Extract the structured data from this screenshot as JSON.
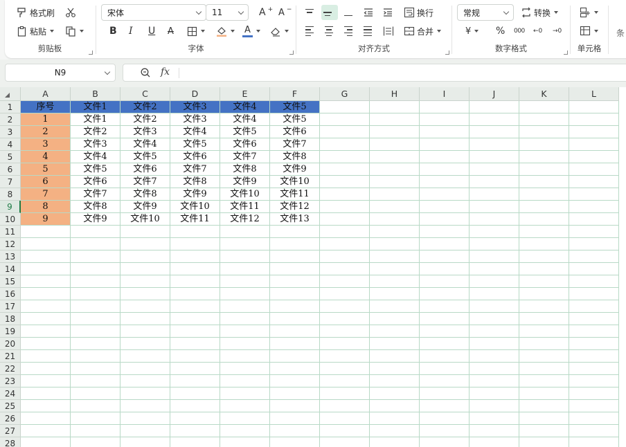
{
  "ribbon": {
    "clipboard": {
      "label": "剪贴板",
      "format_painter": "格式刷",
      "paste": "粘贴"
    },
    "font": {
      "label": "字体",
      "name": "宋体",
      "size": "11",
      "bold": "B",
      "italic": "I",
      "underline": "U",
      "strike": "A",
      "font_grow": "A",
      "font_shrink": "A",
      "font_color": "A"
    },
    "alignment": {
      "label": "对齐方式",
      "wrap": "换行",
      "merge": "合并"
    },
    "number": {
      "label": "数字格式",
      "format": "常规",
      "convert": "转换",
      "currency": "¥",
      "percent": "%",
      "thousands": "000",
      "dec_inc": "←0",
      "dec_dec": "→0"
    },
    "cells": {
      "label": "单元格"
    },
    "conditional": {
      "label": "条"
    }
  },
  "formula_bar": {
    "name_box": "N9",
    "fx": "fx",
    "content": ""
  },
  "sheet": {
    "columns": [
      "A",
      "B",
      "C",
      "D",
      "E",
      "F",
      "G",
      "H",
      "I",
      "J",
      "K",
      "L"
    ],
    "rows": [
      "1",
      "2",
      "3",
      "4",
      "5",
      "6",
      "7",
      "8",
      "9",
      "10",
      "11",
      "12",
      "13",
      "14",
      "15",
      "16",
      "17",
      "18",
      "19",
      "20",
      "21",
      "22",
      "23",
      "24",
      "25",
      "26",
      "27",
      "28"
    ],
    "selected_row": 9,
    "header_color": "#4472c4",
    "index_color": "#f4b183",
    "data": [
      [
        "序号",
        "文件1",
        "文件2",
        "文件3",
        "文件4",
        "文件5"
      ],
      [
        "1",
        "文件1",
        "文件2",
        "文件3",
        "文件4",
        "文件5"
      ],
      [
        "2",
        "文件2",
        "文件3",
        "文件4",
        "文件5",
        "文件6"
      ],
      [
        "3",
        "文件3",
        "文件4",
        "文件5",
        "文件6",
        "文件7"
      ],
      [
        "4",
        "文件4",
        "文件5",
        "文件6",
        "文件7",
        "文件8"
      ],
      [
        "5",
        "文件5",
        "文件6",
        "文件7",
        "文件8",
        "文件9"
      ],
      [
        "6",
        "文件6",
        "文件7",
        "文件8",
        "文件9",
        "文件10"
      ],
      [
        "7",
        "文件7",
        "文件8",
        "文件9",
        "文件10",
        "文件11"
      ],
      [
        "8",
        "文件8",
        "文件9",
        "文件10",
        "文件11",
        "文件12"
      ],
      [
        "9",
        "文件9",
        "文件10",
        "文件11",
        "文件12",
        "文件13"
      ]
    ]
  }
}
